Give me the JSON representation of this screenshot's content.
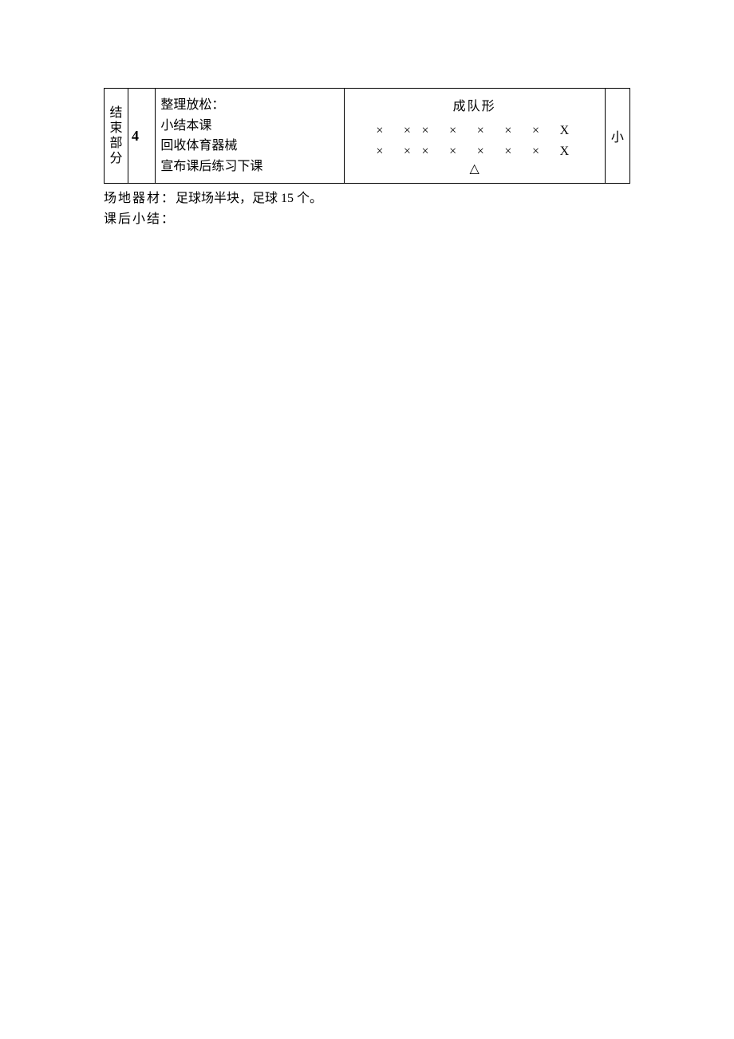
{
  "table": {
    "col1_chars": [
      "结",
      "束",
      "部",
      "分"
    ],
    "col2_value": "4",
    "col3_lines": [
      "整理放松：",
      "小结本课",
      "回收体育器械",
      "宣布课后练习下课"
    ],
    "col4": {
      "title": "成队形",
      "row1": "×　× ×　×　×　×　×　X",
      "row2": "×　× ×　×　×　×　×　X",
      "delta": "△"
    },
    "col5_value": "小"
  },
  "notes": {
    "line1_label": "场地器材：",
    "line1_text": "足球场半块，足球 15 个。",
    "line2_label": "课后小结："
  }
}
